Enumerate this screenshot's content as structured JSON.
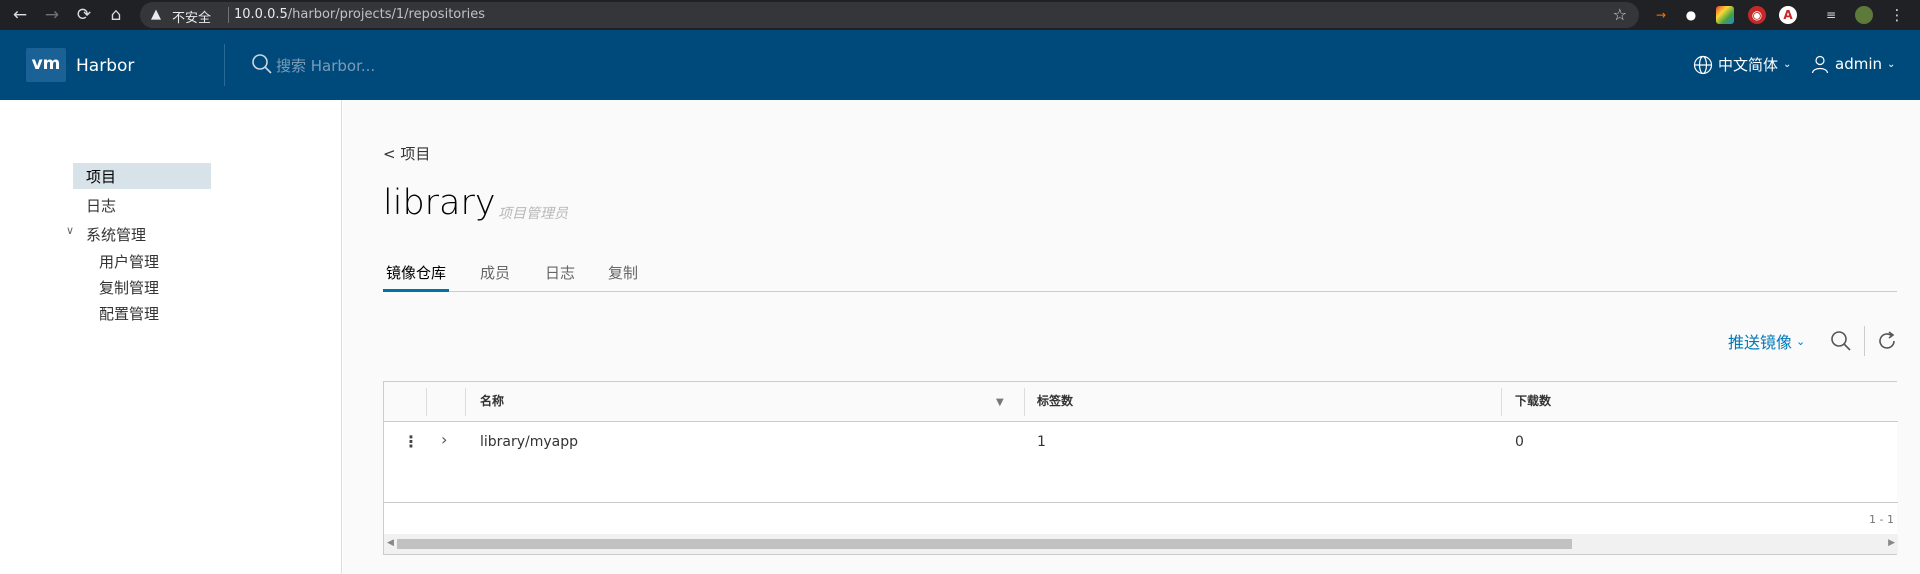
{
  "browser": {
    "security_label": "不安全",
    "url_host": "10.0.0.5",
    "url_path": "/harbor/projects/1/repositories"
  },
  "header": {
    "app_name": "Harbor",
    "logo_text": "vm",
    "search_placeholder": "搜索 Harbor...",
    "language": "中文简体",
    "user": "admin"
  },
  "sidebar": {
    "projects": "项目",
    "logs": "日志",
    "admin": "系统管理",
    "admin_items": {
      "users": "用户管理",
      "replication": "复制管理",
      "config": "配置管理"
    }
  },
  "main": {
    "back_link": "< 项目",
    "project_name": "library",
    "project_role": "项目管理员",
    "tabs": {
      "repositories": "镜像仓库",
      "members": "成员",
      "logs": "日志",
      "replication": "复制"
    },
    "push_button": "推送镜像"
  },
  "table": {
    "columns": {
      "name": "名称",
      "tags": "标签数",
      "pulls": "下载数"
    },
    "rows": [
      {
        "name": "library/myapp",
        "tags": "1",
        "pulls": "0"
      }
    ],
    "footer_count": "1 - 1 "
  },
  "colors": {
    "header_bg": "#004a7b",
    "accent": "#0079b8",
    "active_tab": "#0072a3",
    "sidebar_active": "#d8e3e9"
  }
}
